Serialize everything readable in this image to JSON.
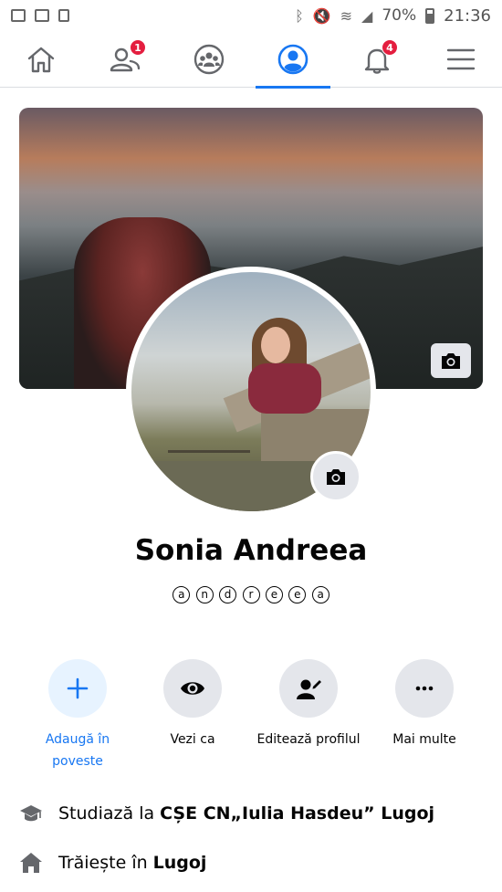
{
  "status_bar": {
    "battery": "70%",
    "time": "21:36",
    "colors": {
      "icon": "#666666"
    }
  },
  "nav": {
    "items": [
      {
        "name": "home",
        "icon": "home-icon"
      },
      {
        "name": "friends",
        "icon": "friends-icon",
        "badge": "1"
      },
      {
        "name": "groups",
        "icon": "groups-icon"
      },
      {
        "name": "profile",
        "icon": "profile-icon",
        "active": true
      },
      {
        "name": "notifications",
        "icon": "bell-icon",
        "badge": "4"
      },
      {
        "name": "menu",
        "icon": "menu-icon"
      }
    ],
    "colors": {
      "accent": "#1877f2",
      "badge": "#e41e3f"
    }
  },
  "profile": {
    "name": "Sonia Andreea",
    "nickname": [
      "a",
      "n",
      "d",
      "r",
      "e",
      "e",
      "a"
    ]
  },
  "actions": [
    {
      "label_line1": "Adaugă în",
      "label_line2": "poveste",
      "icon": "plus-icon"
    },
    {
      "label_line1": "Vezi ca",
      "label_line2": "",
      "icon": "eye-icon"
    },
    {
      "label_line1": "Editează profilul",
      "label_line2": "",
      "icon": "edit-profile-icon"
    },
    {
      "label_line1": "Mai multe",
      "label_line2": "",
      "icon": "more-icon"
    }
  ],
  "info": {
    "education_prefix": "Studiază la",
    "education_place": "CȘE CN„Iulia Hasdeu” Lugoj",
    "lives_prefix": "Trăiește în",
    "lives_place": "Lugoj"
  }
}
